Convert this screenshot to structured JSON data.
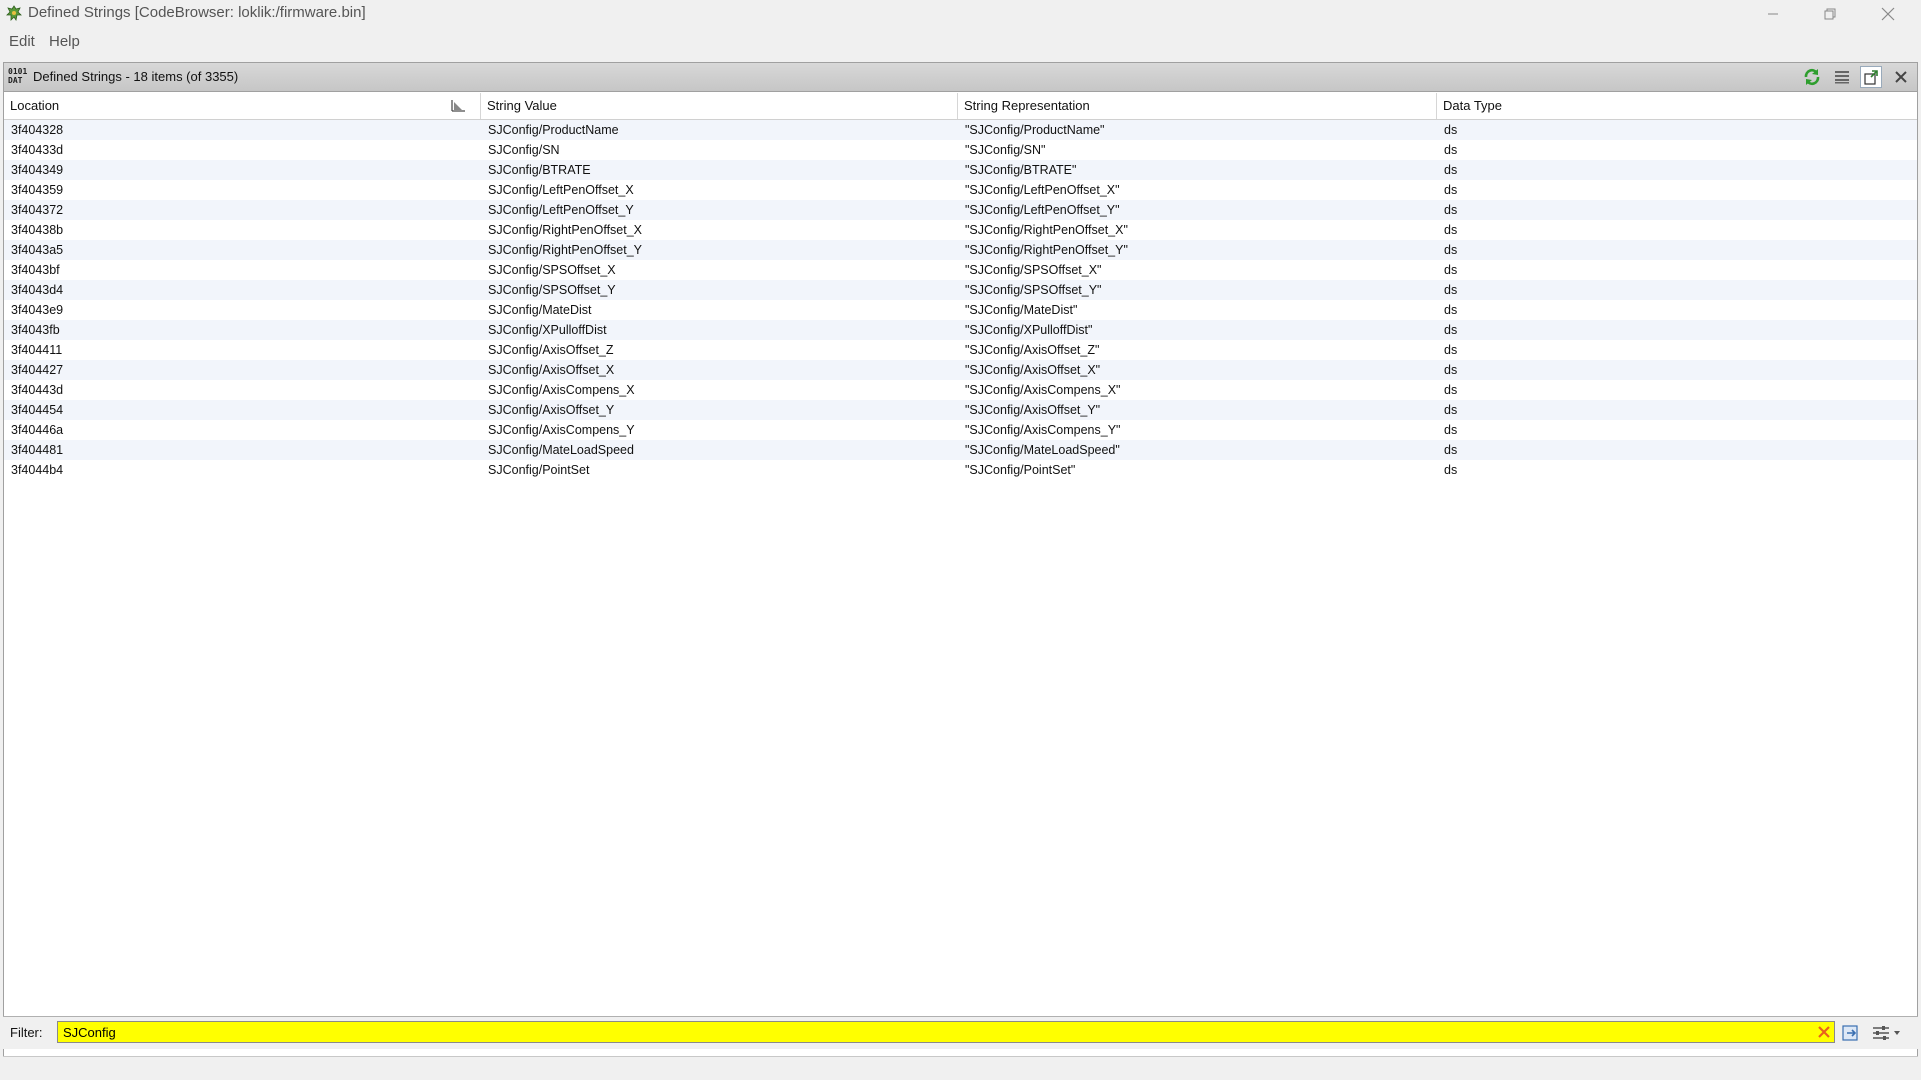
{
  "window": {
    "title": "Defined Strings [CodeBrowser: loklik:/firmware.bin]"
  },
  "menu": {
    "items": [
      {
        "label": "Edit"
      },
      {
        "label": "Help"
      }
    ]
  },
  "panel": {
    "icon_text_top": "0101",
    "icon_text_bottom": "DAT",
    "title": "Defined Strings - 18 items (of 3355)"
  },
  "table": {
    "columns": [
      "Location",
      "String Value",
      "String Representation",
      "Data Type"
    ],
    "rows": [
      [
        "3f404328",
        "SJConfig/ProductName",
        "\"SJConfig/ProductName\"",
        "ds"
      ],
      [
        "3f40433d",
        "SJConfig/SN",
        "\"SJConfig/SN\"",
        "ds"
      ],
      [
        "3f404349",
        "SJConfig/BTRATE",
        "\"SJConfig/BTRATE\"",
        "ds"
      ],
      [
        "3f404359",
        "SJConfig/LeftPenOffset_X",
        "\"SJConfig/LeftPenOffset_X\"",
        "ds"
      ],
      [
        "3f404372",
        "SJConfig/LeftPenOffset_Y",
        "\"SJConfig/LeftPenOffset_Y\"",
        "ds"
      ],
      [
        "3f40438b",
        "SJConfig/RightPenOffset_X",
        "\"SJConfig/RightPenOffset_X\"",
        "ds"
      ],
      [
        "3f4043a5",
        "SJConfig/RightPenOffset_Y",
        "\"SJConfig/RightPenOffset_Y\"",
        "ds"
      ],
      [
        "3f4043bf",
        "SJConfig/SPSOffset_X",
        "\"SJConfig/SPSOffset_X\"",
        "ds"
      ],
      [
        "3f4043d4",
        "SJConfig/SPSOffset_Y",
        "\"SJConfig/SPSOffset_Y\"",
        "ds"
      ],
      [
        "3f4043e9",
        "SJConfig/MateDist",
        "\"SJConfig/MateDist\"",
        "ds"
      ],
      [
        "3f4043fb",
        "SJConfig/XPulloffDist",
        "\"SJConfig/XPulloffDist\"",
        "ds"
      ],
      [
        "3f404411",
        "SJConfig/AxisOffset_Z",
        "\"SJConfig/AxisOffset_Z\"",
        "ds"
      ],
      [
        "3f404427",
        "SJConfig/AxisOffset_X",
        "\"SJConfig/AxisOffset_X\"",
        "ds"
      ],
      [
        "3f40443d",
        "SJConfig/AxisCompens_X",
        "\"SJConfig/AxisCompens_X\"",
        "ds"
      ],
      [
        "3f404454",
        "SJConfig/AxisOffset_Y",
        "\"SJConfig/AxisOffset_Y\"",
        "ds"
      ],
      [
        "3f40446a",
        "SJConfig/AxisCompens_Y",
        "\"SJConfig/AxisCompens_Y\"",
        "ds"
      ],
      [
        "3f404481",
        "SJConfig/MateLoadSpeed",
        "\"SJConfig/MateLoadSpeed\"",
        "ds"
      ],
      [
        "3f4044b4",
        "SJConfig/PointSet",
        "\"SJConfig/PointSet\"",
        "ds"
      ]
    ]
  },
  "filter": {
    "label": "Filter:",
    "value": "SJConfig"
  },
  "colors": {
    "filter_background": "#ffff00",
    "row_alt": "#f2f5fb",
    "refresh_green": "#2e9e2e",
    "clear_x": "#e8601c"
  },
  "icons": [
    "app-icon",
    "refresh-icon",
    "list-icon",
    "snapshot-icon",
    "close-icon",
    "sort-icon",
    "clear-filter-icon",
    "filter-export-icon",
    "filter-options-icon"
  ]
}
